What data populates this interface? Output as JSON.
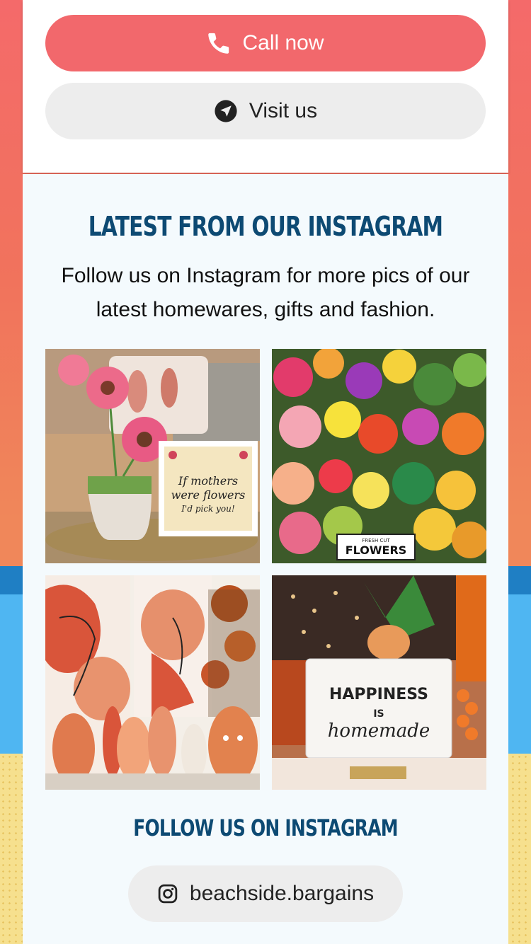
{
  "actions": {
    "call_label": "Call now",
    "visit_label": "Visit us",
    "call_icon": "phone-icon",
    "visit_icon": "navigation-arrow-icon"
  },
  "instagram": {
    "heading": "LATEST FROM OUR INSTAGRAM",
    "description": "Follow us on Instagram for more pics of our latest homewares, gifts and fashion.",
    "posts": [
      {
        "sign_text": "If mothers were flowers I'd pick you!"
      },
      {
        "sign_text": "FLOWERS",
        "sign_small": "FRESH CUT"
      },
      {
        "sign_text": ""
      },
      {
        "sign_line1": "HAPPINESS",
        "sign_line2": "IS",
        "sign_line3": "homemade"
      }
    ],
    "follow_heading": "FOLLOW US ON INSTAGRAM",
    "handle": "beachside.bargains",
    "handle_icon": "instagram-icon"
  },
  "colors": {
    "call_button": "#f2686c",
    "heading": "#0d4a73",
    "secondary_button": "#ededed"
  }
}
